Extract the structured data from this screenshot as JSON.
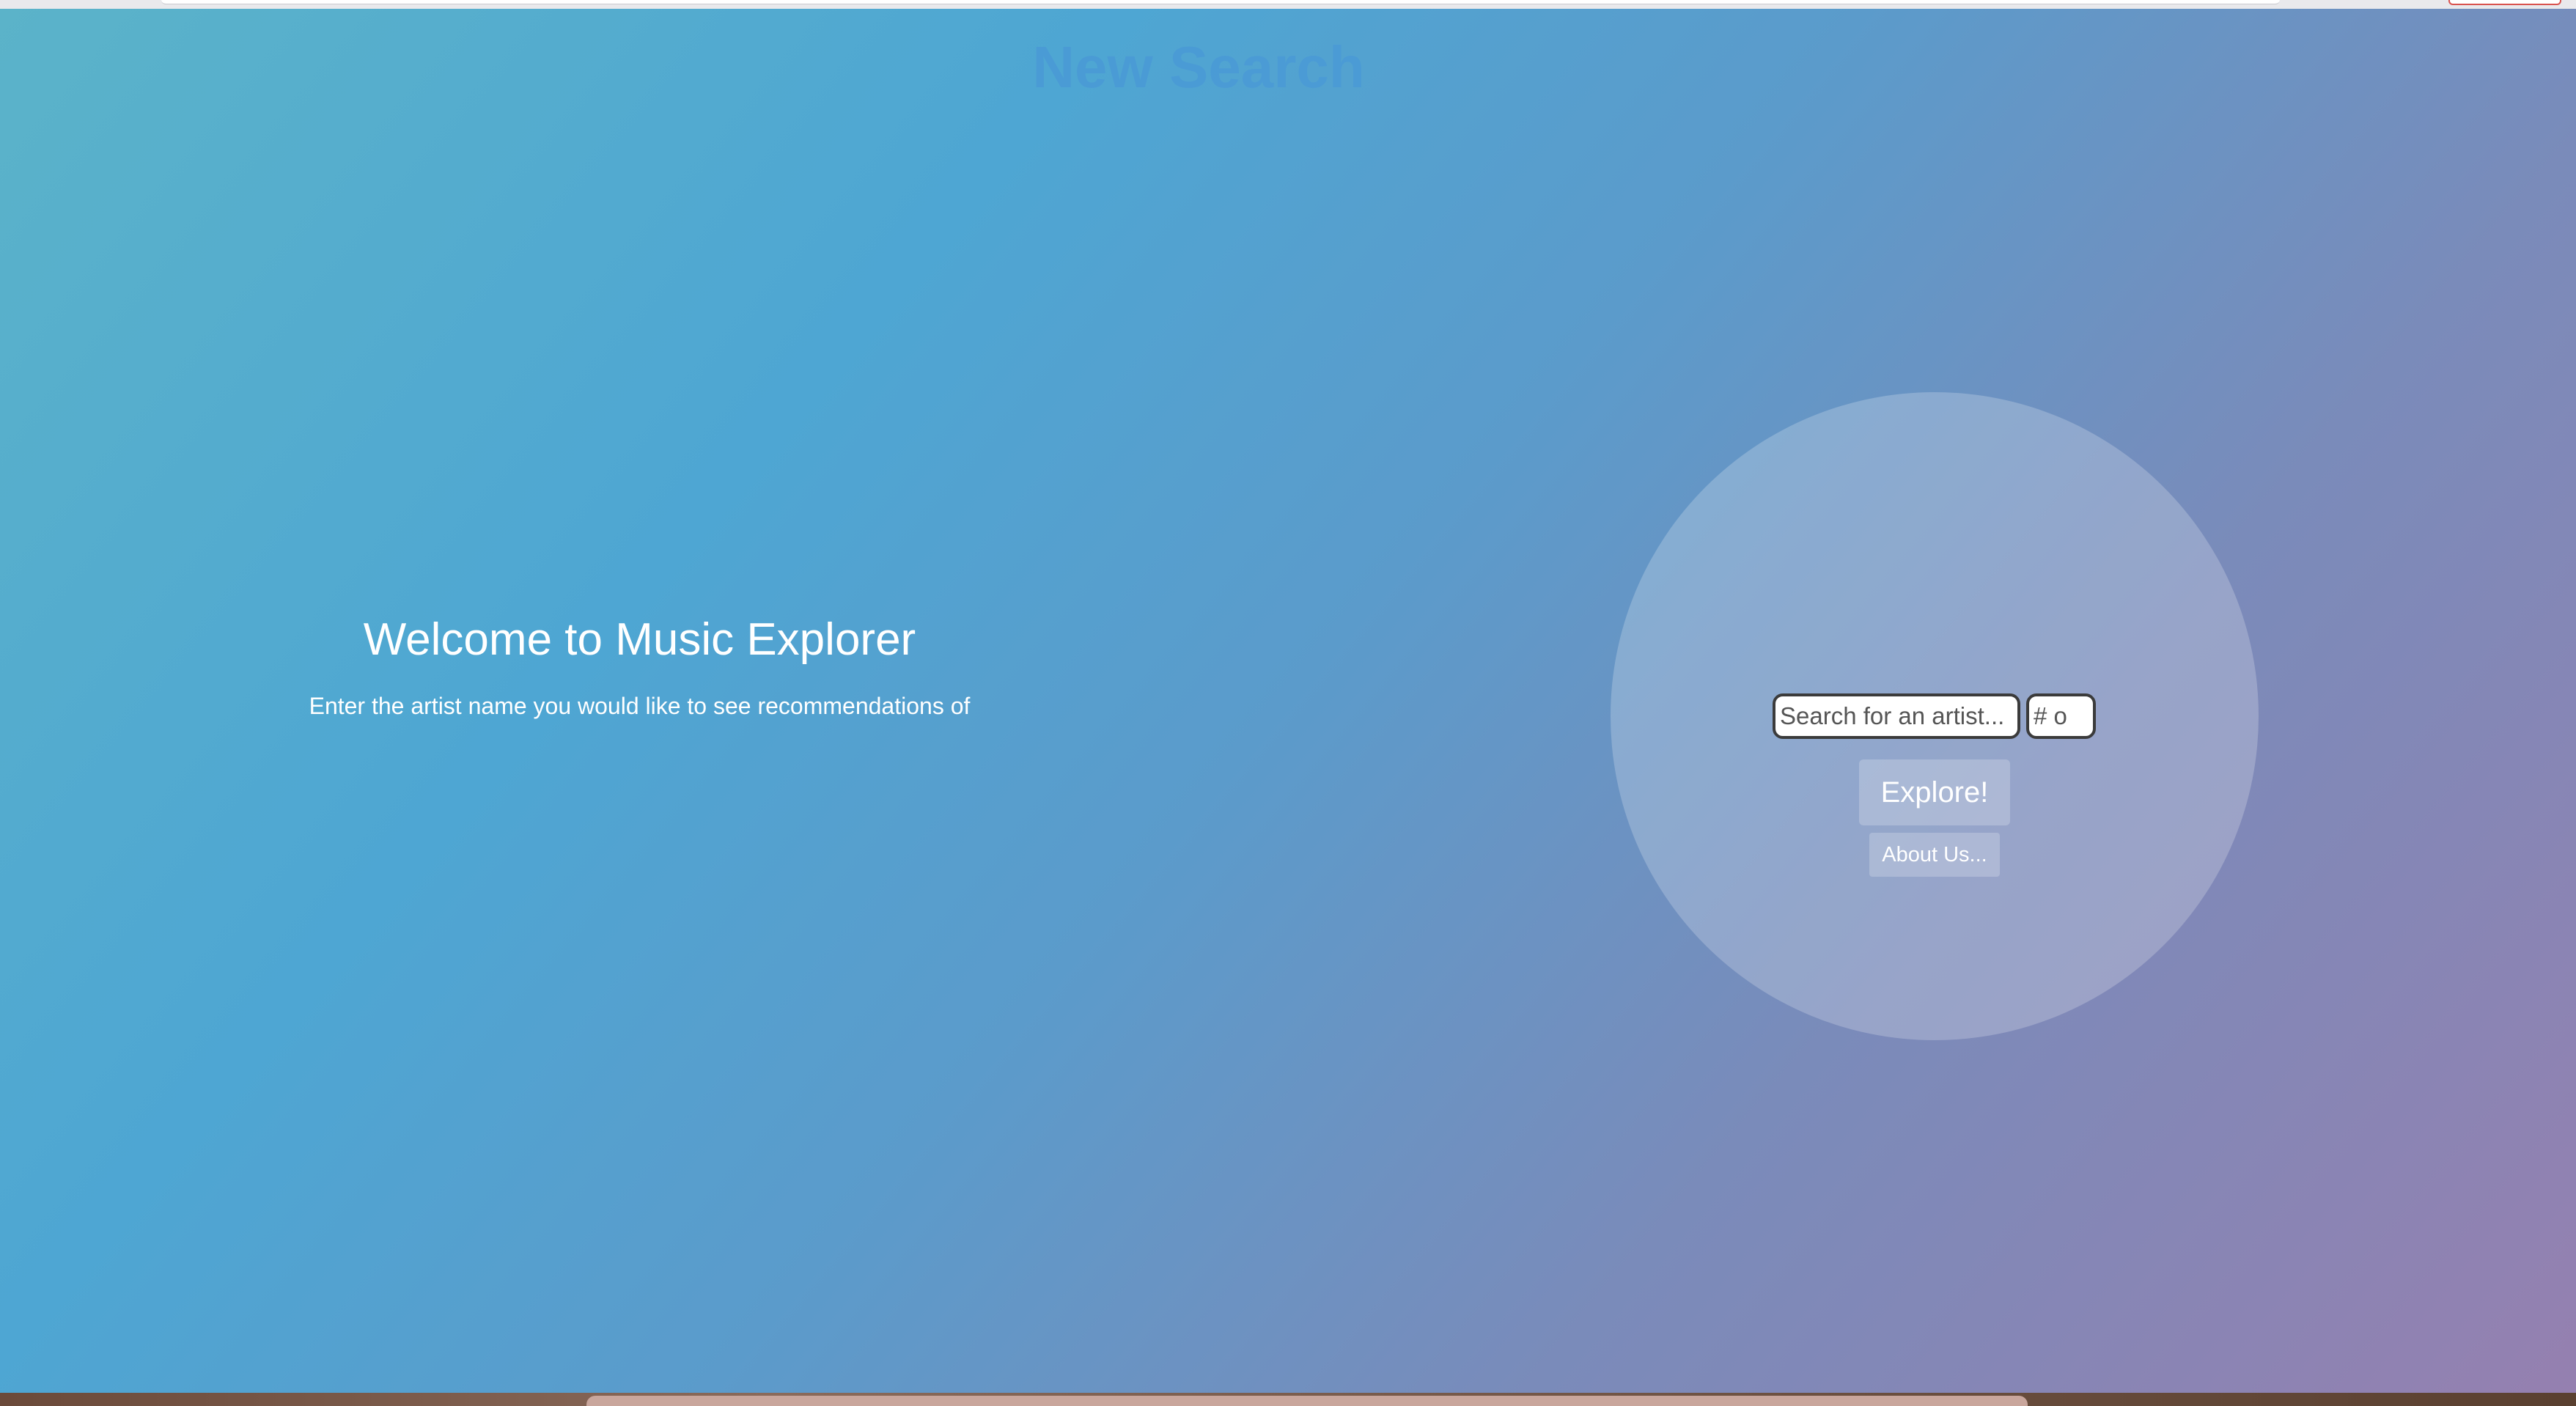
{
  "page": {
    "header_title": "New Search",
    "welcome_title": "Welcome to Music Explorer",
    "welcome_text": "Enter the artist name you would like to see recommendations of"
  },
  "search": {
    "artist_placeholder": "Search for an artist...",
    "count_placeholder": "# o",
    "artist_value": "",
    "count_value": ""
  },
  "buttons": {
    "explore_label": "Explore!",
    "about_label": "About Us..."
  },
  "colors": {
    "gradient_start": "#5bb3c9",
    "gradient_end": "#9580b0",
    "text": "#ffffff"
  }
}
